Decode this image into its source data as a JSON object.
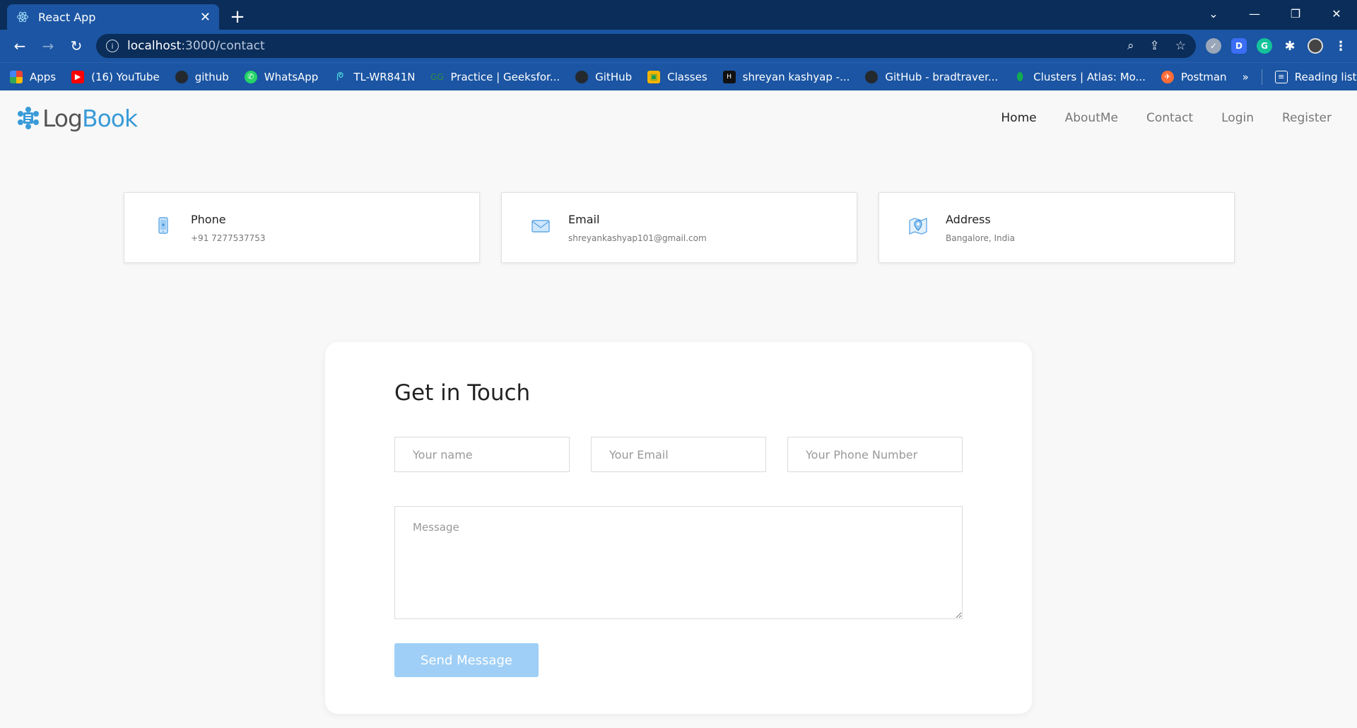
{
  "browser": {
    "tab_title": "React App",
    "url_host": "localhost",
    "url_path": ":3000/contact",
    "bookmarks": [
      {
        "label": "Apps",
        "icon": "apps-grid-icon",
        "color": "#ea4335"
      },
      {
        "label": "(16) YouTube",
        "icon": "youtube-icon",
        "color": "#ff0000"
      },
      {
        "label": "github",
        "icon": "github-icon",
        "color": "#24292e"
      },
      {
        "label": "WhatsApp",
        "icon": "whatsapp-icon",
        "color": "#25d366"
      },
      {
        "label": "TL-WR841N",
        "icon": "tplink-icon",
        "color": "#4acbd6"
      },
      {
        "label": "Practice | Geeksfor...",
        "icon": "geeksforgeeks-icon",
        "color": "#2f8d46"
      },
      {
        "label": "GitHub",
        "icon": "github-icon",
        "color": "#24292e"
      },
      {
        "label": "Classes",
        "icon": "classroom-icon",
        "color": "#f4b400"
      },
      {
        "label": "shreyan kashyap -...",
        "icon": "hackerrank-icon",
        "color": "#111111"
      },
      {
        "label": "GitHub - bradtraver...",
        "icon": "github-icon",
        "color": "#24292e"
      },
      {
        "label": "Clusters | Atlas: Mo...",
        "icon": "mongodb-icon",
        "color": "#13aa52"
      },
      {
        "label": "Postman",
        "icon": "postman-icon",
        "color": "#ff6c37"
      }
    ],
    "more_bookmarks": "»",
    "reading_list": "Reading list"
  },
  "site": {
    "logo_left": "Log",
    "logo_right": "Book",
    "menu": [
      {
        "label": "Home",
        "active": true
      },
      {
        "label": "AboutMe",
        "active": false
      },
      {
        "label": "Contact",
        "active": false
      },
      {
        "label": "Login",
        "active": false
      },
      {
        "label": "Register",
        "active": false
      }
    ]
  },
  "contact_cards": [
    {
      "title": "Phone",
      "value": "+91 7277537753",
      "icon": "phone-icon"
    },
    {
      "title": "Email",
      "value": "shreyankashyap101@gmail.com",
      "icon": "envelope-icon"
    },
    {
      "title": "Address",
      "value": "Bangalore, India",
      "icon": "map-pin-icon"
    }
  ],
  "form": {
    "title": "Get in Touch",
    "name_placeholder": "Your name",
    "email_placeholder": "Your Email",
    "phone_placeholder": "Your Phone Number",
    "message_placeholder": "Message",
    "submit_label": "Send Message"
  },
  "colors": {
    "chrome_dark": "#0b2d59",
    "chrome": "#1b55a3",
    "brand_blue": "#3a9bd8",
    "button_disabled": "#9fcff6"
  }
}
